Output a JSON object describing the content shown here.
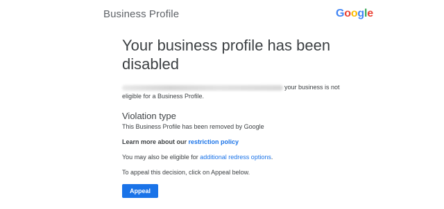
{
  "header": {
    "title": "Business Profile",
    "logo": {
      "letters": [
        "G",
        "o",
        "o",
        "g",
        "l",
        "e"
      ],
      "colors": [
        "#4285F4",
        "#EA4335",
        "#FBBC05",
        "#4285F4",
        "#34A853",
        "#EA4335"
      ]
    }
  },
  "main": {
    "headline": "Your business profile has been disabled",
    "reason_tail": "your business is not",
    "reason_line2": "eligible for a Business Profile.",
    "violation_title": "Violation type",
    "violation_text": "This Business Profile has been removed by Google",
    "learn_prefix": "Learn more about our",
    "learn_link": "restriction policy",
    "redress_prefix": "You may also be eligible for",
    "redress_link": "additional redress options",
    "redress_suffix": ".",
    "appeal_text": "To appeal this decision, click on Appeal below.",
    "appeal_button": "Appeal"
  },
  "colors": {
    "primary": "#1a73e8",
    "text": "#3c4043",
    "muted": "#5f6368"
  }
}
